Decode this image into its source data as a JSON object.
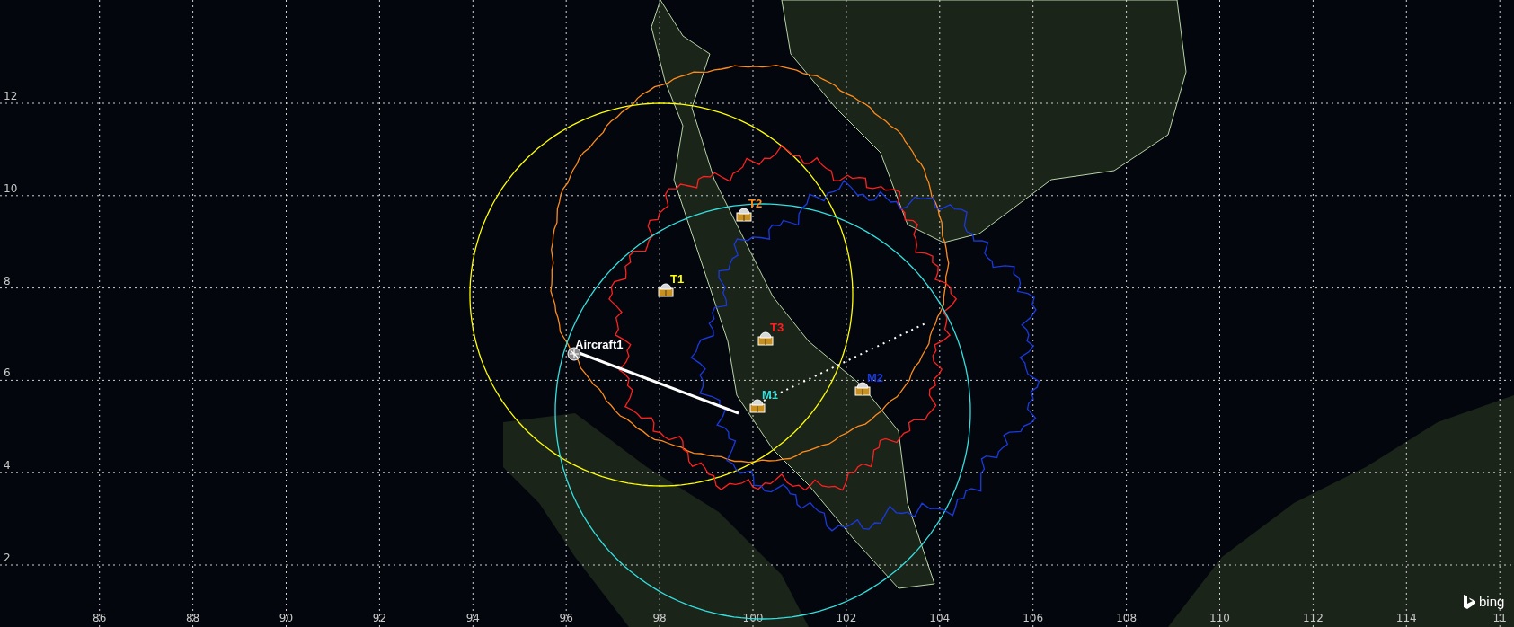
{
  "map": {
    "x_ticks": [
      "86",
      "88",
      "90",
      "92",
      "94",
      "96",
      "98",
      "100",
      "102",
      "104",
      "106",
      "108",
      "110",
      "112",
      "114",
      "11"
    ],
    "y_ticks": [
      "12",
      "10",
      "8",
      "6",
      "4",
      "2"
    ],
    "sites": [
      {
        "label": "T2",
        "color": "#ff8c1a"
      },
      {
        "label": "T1",
        "color": "#ffff00"
      },
      {
        "label": "T3",
        "color": "#ff2020"
      },
      {
        "label": "M1",
        "color": "#33e0e0"
      },
      {
        "label": "M2",
        "color": "#1a3adf"
      }
    ],
    "aircraft": {
      "label": "Aircraft1"
    },
    "attribution": {
      "text": "bing"
    }
  }
}
